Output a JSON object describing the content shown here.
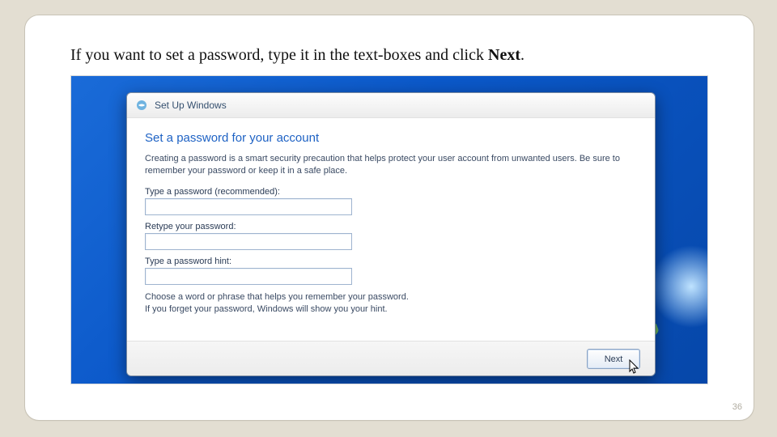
{
  "slide": {
    "caption_prefix": "If you want to set a password, type it in the text-boxes and click ",
    "caption_strong": "Next",
    "caption_suffix": ".",
    "page_number": "36"
  },
  "window": {
    "title": "Set Up Windows",
    "heading": "Set a password for your account",
    "description": "Creating a password is a smart security precaution that helps protect your user account from unwanted users. Be sure to remember your password or keep it in a safe place.",
    "password_label": "Type a password (recommended):",
    "password_value": "",
    "retype_label": "Retype your password:",
    "retype_value": "",
    "hint_label": "Type a password hint:",
    "hint_value": "",
    "hint_help": "Choose a word or phrase that helps you remember your password.\nIf you forget your password, Windows will show you your hint.",
    "next_button": "Next"
  }
}
